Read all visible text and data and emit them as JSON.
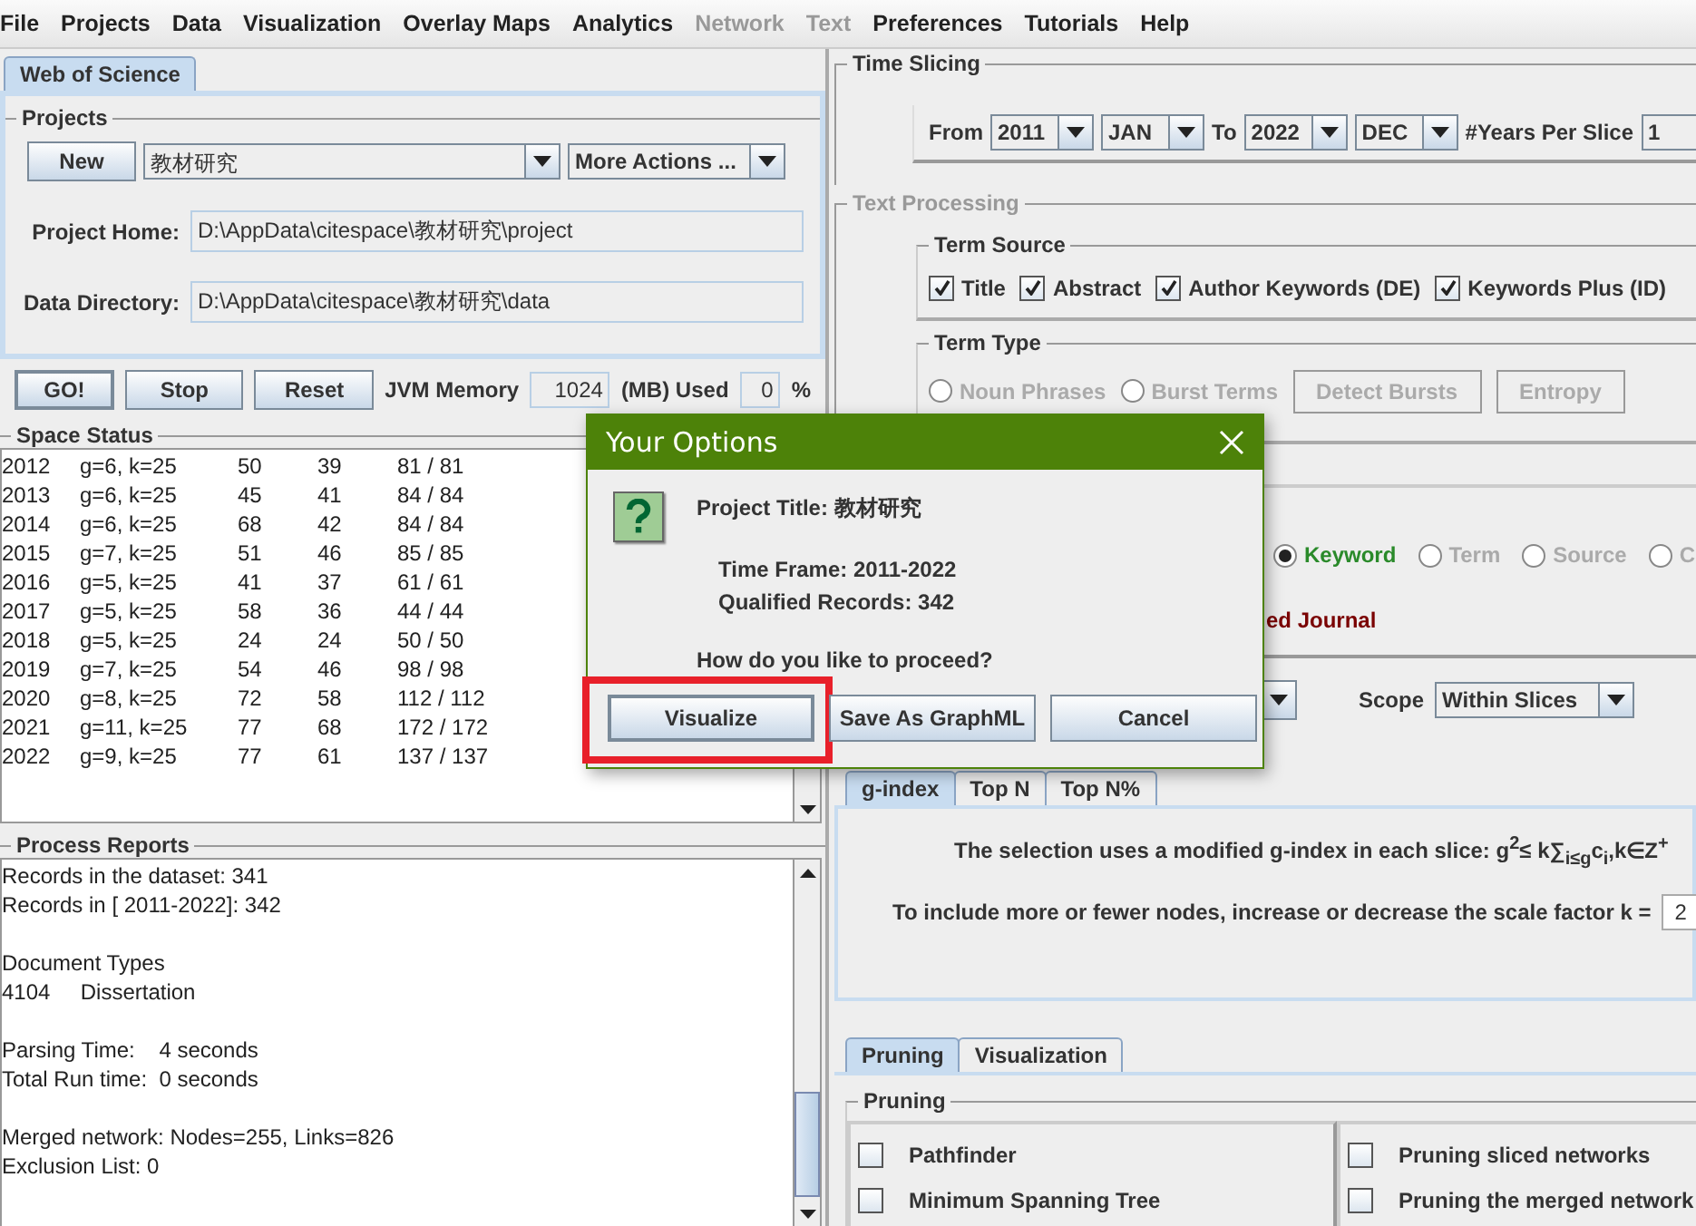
{
  "menu": [
    {
      "label": "File",
      "disabled": false
    },
    {
      "label": "Projects",
      "disabled": false
    },
    {
      "label": "Data",
      "disabled": false
    },
    {
      "label": "Visualization",
      "disabled": false
    },
    {
      "label": "Overlay Maps",
      "disabled": false
    },
    {
      "label": "Analytics",
      "disabled": false
    },
    {
      "label": "Network",
      "disabled": true
    },
    {
      "label": "Text",
      "disabled": true
    },
    {
      "label": "Preferences",
      "disabled": false
    },
    {
      "label": "Tutorials",
      "disabled": false
    },
    {
      "label": "Help",
      "disabled": false
    }
  ],
  "source_tab": {
    "label": "Web of Science",
    "selected": true
  },
  "projects": {
    "title": "Projects",
    "new_button": "New",
    "project": "教材研究",
    "more_actions": "More Actions ...",
    "project_home_label": "Project Home:",
    "project_home": "D:\\AppData\\citespace\\教材研究\\project",
    "data_directory_label": "Data Directory:",
    "data_directory": "D:\\AppData\\citespace\\教材研究\\data"
  },
  "controls": {
    "buttons": [
      "GO!",
      "Stop",
      "Reset"
    ],
    "jvm_label": "JVM Memory",
    "jvm_value": "1024",
    "used_label": "(MB) Used",
    "used_value": "0",
    "percent": "%"
  },
  "space_status": {
    "title": "Space Status",
    "rows": [
      [
        "2012",
        "g=6, k=25",
        "50",
        "39",
        "81 / 81"
      ],
      [
        "2013",
        "g=6, k=25",
        "45",
        "41",
        "84 / 84"
      ],
      [
        "2014",
        "g=6, k=25",
        "68",
        "42",
        "84 / 84"
      ],
      [
        "2015",
        "g=7, k=25",
        "51",
        "46",
        "85 / 85"
      ],
      [
        "2016",
        "g=5, k=25",
        "41",
        "37",
        "61 / 61"
      ],
      [
        "2017",
        "g=5, k=25",
        "58",
        "36",
        "44 / 44"
      ],
      [
        "2018",
        "g=5, k=25",
        "24",
        "24",
        "50 / 50"
      ],
      [
        "2019",
        "g=7, k=25",
        "54",
        "46",
        "98 / 98"
      ],
      [
        "2020",
        "g=8, k=25",
        "72",
        "58",
        "112 / 112"
      ],
      [
        "2021",
        "g=11, k=25",
        "77",
        "68",
        "172 / 172"
      ],
      [
        "2022",
        "g=9, k=25",
        "77",
        "61",
        "137 / 137"
      ]
    ]
  },
  "process_reports": {
    "title": "Process Reports",
    "paragraphs": [
      [
        "Records in the dataset: 341",
        "Records in [ 2011-2022]: 342"
      ],
      [
        "Document Types",
        "4104     Dissertation"
      ],
      [
        "Parsing Time:    4 seconds",
        "Total Run time:  0 seconds"
      ],
      [
        "Merged network: Nodes=255, Links=826",
        "Exclusion List: 0"
      ]
    ]
  },
  "time_slicing": {
    "title": "Time Slicing",
    "from_label": "From",
    "from_year": "2011",
    "from_month": "JAN",
    "to_label": "To",
    "to_year": "2022",
    "to_month": "DEC",
    "years_label": "#Years Per Slice",
    "years": "1"
  },
  "text_processing": {
    "title": "Text Processing",
    "disabled": true,
    "term_source": {
      "title": "Term Source",
      "items": [
        {
          "label": "Title",
          "checked": true
        },
        {
          "label": "Abstract",
          "checked": true
        },
        {
          "label": "Author Keywords (DE)",
          "checked": true
        },
        {
          "label": "Keywords Plus (ID)",
          "checked": true
        }
      ]
    },
    "term_type": {
      "title": "Term Type",
      "options": [
        {
          "label": "Noun Phrases",
          "selected": false,
          "disabled": true
        },
        {
          "label": "Burst Terms",
          "selected": false,
          "disabled": true
        }
      ],
      "buttons": [
        {
          "label": "Detect Bursts",
          "disabled": true
        },
        {
          "label": "Entropy",
          "disabled": true
        }
      ]
    }
  },
  "node_types": {
    "options": [
      {
        "label": "Keyword",
        "selected": true,
        "disabled": false
      },
      {
        "label": "Term",
        "selected": false,
        "disabled": true
      },
      {
        "label": "Source",
        "selected": false,
        "disabled": true
      },
      {
        "label": "C",
        "selected": false,
        "disabled": true
      }
    ],
    "partial_label": "ed Journal"
  },
  "selection": {
    "scope_label": "Scope",
    "scope": "Within Slices"
  },
  "criteria_tabs": [
    {
      "label": "g-index",
      "selected": true
    },
    {
      "label": "Top N",
      "selected": false
    },
    {
      "label": "Top N%",
      "selected": false
    }
  ],
  "g_index": {
    "formula": "The selection uses a modified g-index in each slice: g$^{2}$≤ k∑$_{i≤g}$c$_{i}$,k∈Z$^{+}$",
    "scale_label": "To include more or fewer nodes, increase or decrease the scale factor k =",
    "scale_value": "2"
  },
  "bottom_tabs": [
    {
      "label": "Pruning",
      "selected": true
    },
    {
      "label": "Visualization",
      "selected": false
    }
  ],
  "pruning": {
    "title": "Pruning",
    "items": [
      {
        "label": "Pathfinder",
        "checked": false
      },
      {
        "label": "Minimum Spanning Tree",
        "checked": false
      },
      {
        "label": "Pruning sliced networks",
        "checked": false
      },
      {
        "label": "Pruning the merged network",
        "checked": false
      }
    ]
  },
  "dialog": {
    "title": "Your Options",
    "project_title": "Project Title: 教材研究",
    "time_frame": "Time Frame: 2011-2022",
    "records": "Qualified Records: 342",
    "question": "How do you like to proceed?",
    "buttons": [
      {
        "label": "Visualize",
        "highlighted": true
      },
      {
        "label": "Save As GraphML",
        "highlighted": false
      },
      {
        "label": "Cancel",
        "highlighted": false
      }
    ]
  }
}
